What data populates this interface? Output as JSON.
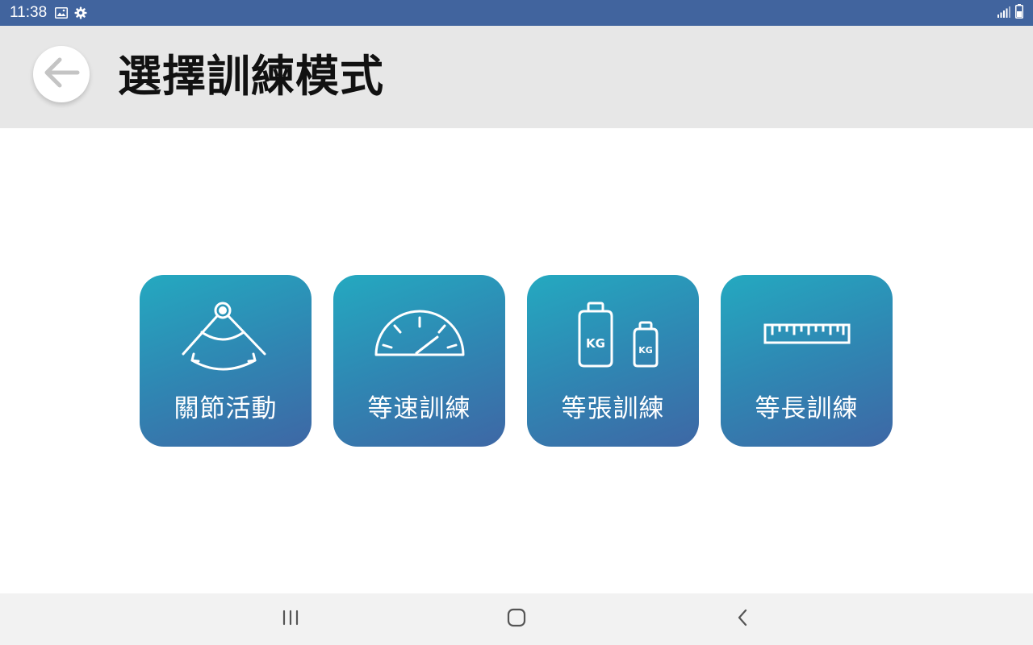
{
  "status_bar": {
    "time": "11:38",
    "icons": [
      "image-icon",
      "gear-icon",
      "signal-icon",
      "battery-icon"
    ]
  },
  "header": {
    "back_icon": "arrow-left-icon",
    "title": "選擇訓練模式"
  },
  "modes": [
    {
      "label": "關節活動",
      "icon": "joint-angle-icon"
    },
    {
      "label": "等速訓練",
      "icon": "speedometer-icon"
    },
    {
      "label": "等張訓練",
      "icon": "weights-kg-icon"
    },
    {
      "label": "等長訓練",
      "icon": "ruler-icon"
    }
  ],
  "nav_bar": {
    "icons": [
      "recent-apps-icon",
      "home-icon",
      "back-icon"
    ]
  },
  "colors": {
    "status_bar": "#41649e",
    "header_bg": "#e7e7e7",
    "card_gradient_start": "#24a9c0",
    "card_gradient_end": "#3e67a5",
    "nav_bar_bg": "#f2f2f2"
  }
}
